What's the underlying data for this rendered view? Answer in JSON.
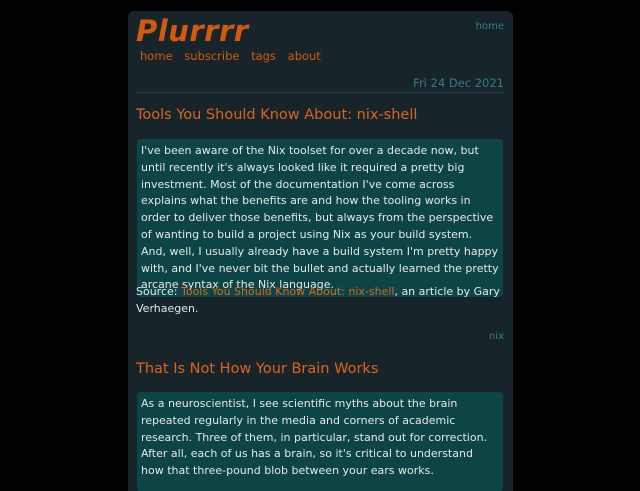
{
  "site": {
    "title": "Plurrrr",
    "top_link": "home",
    "nav": [
      "home",
      "subscribe",
      "tags",
      "about"
    ]
  },
  "date": "Fri 24 Dec 2021",
  "posts": [
    {
      "title": "Tools You Should Know About: nix-shell",
      "quote": "I've been aware of the Nix toolset for over a decade now, but until recently it's always looked like it required a pretty big investment. Most of the documentation I've come across explains what the benefits are and how the tooling works in order to deliver those benefits, but always from the perspective of wanting to build a project using Nix as your build system. And, well, I usually already have a build system I'm pretty happy with, and I've never bit the bullet and actually learned the pretty arcane syntax of the Nix language.",
      "source_prefix": "Source: ",
      "source_link": "Tools You Should Know About: nix-shell",
      "source_suffix": ", an article by Gary Verhaegen.",
      "tag": "nix"
    },
    {
      "title": "That Is Not How Your Brain Works",
      "quote": "As a neuroscientist, I see scientific myths about the brain repeated regularly in the media and corners of academic research. Three of them, in particular, stand out for correction. After all, each of us has a brain, so it's critical to understand how that three-pound blob between your ears works."
    }
  ],
  "colors": {
    "accent": "#d4580e",
    "link_teal": "#2f7f82",
    "card_bg": "#17252b",
    "quote_bg": "#0d4446",
    "text": "#e7e7e7"
  }
}
